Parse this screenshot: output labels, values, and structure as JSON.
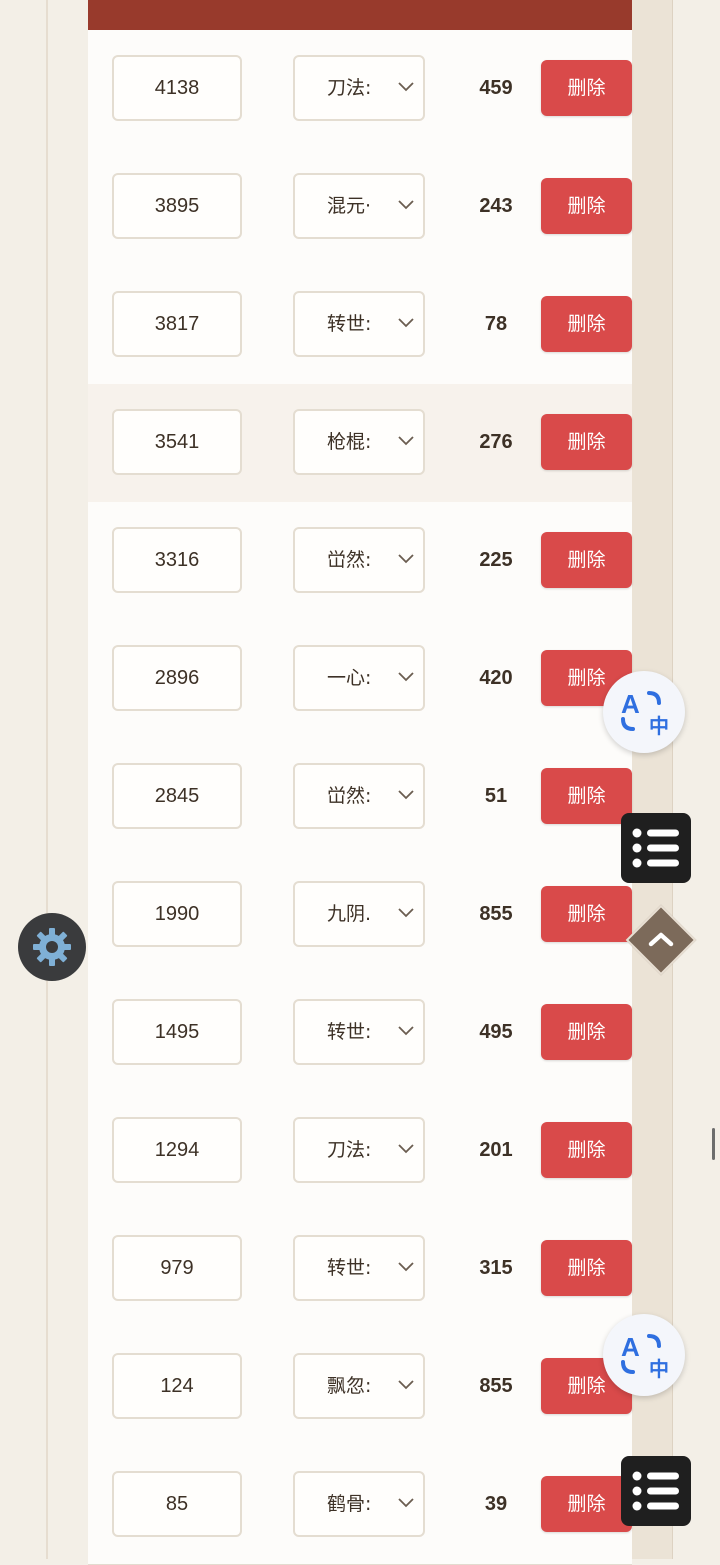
{
  "table": {
    "delete_label": "删除",
    "rows": [
      {
        "value": "4138",
        "skill": "刀法:",
        "count": "459"
      },
      {
        "value": "3895",
        "skill": "混元·",
        "count": "243"
      },
      {
        "value": "3817",
        "skill": "转世:",
        "count": "78"
      },
      {
        "value": "3541",
        "skill": "枪棍:",
        "count": "276"
      },
      {
        "value": "3316",
        "skill": "峃然:",
        "count": "225"
      },
      {
        "value": "2896",
        "skill": "一心:",
        "count": "420"
      },
      {
        "value": "2845",
        "skill": "峃然:",
        "count": "51"
      },
      {
        "value": "1990",
        "skill": "九阴.",
        "count": "855"
      },
      {
        "value": "1495",
        "skill": "转世:",
        "count": "495"
      },
      {
        "value": "1294",
        "skill": "刀法:",
        "count": "201"
      },
      {
        "value": "979",
        "skill": "转世:",
        "count": "315"
      },
      {
        "value": "124",
        "skill": "飘忽:",
        "count": "855"
      },
      {
        "value": "85",
        "skill": "鹤骨:",
        "count": "39"
      }
    ]
  },
  "floating": {
    "translate_icon": "translate-icon",
    "menu_icon": "list-menu-icon",
    "settings_icon": "gear-icon",
    "scroll_top_icon": "chevron-up-icon"
  },
  "colors": {
    "header": "#983a2c",
    "delete_button": "#d94a4a",
    "text": "#3d3126"
  }
}
